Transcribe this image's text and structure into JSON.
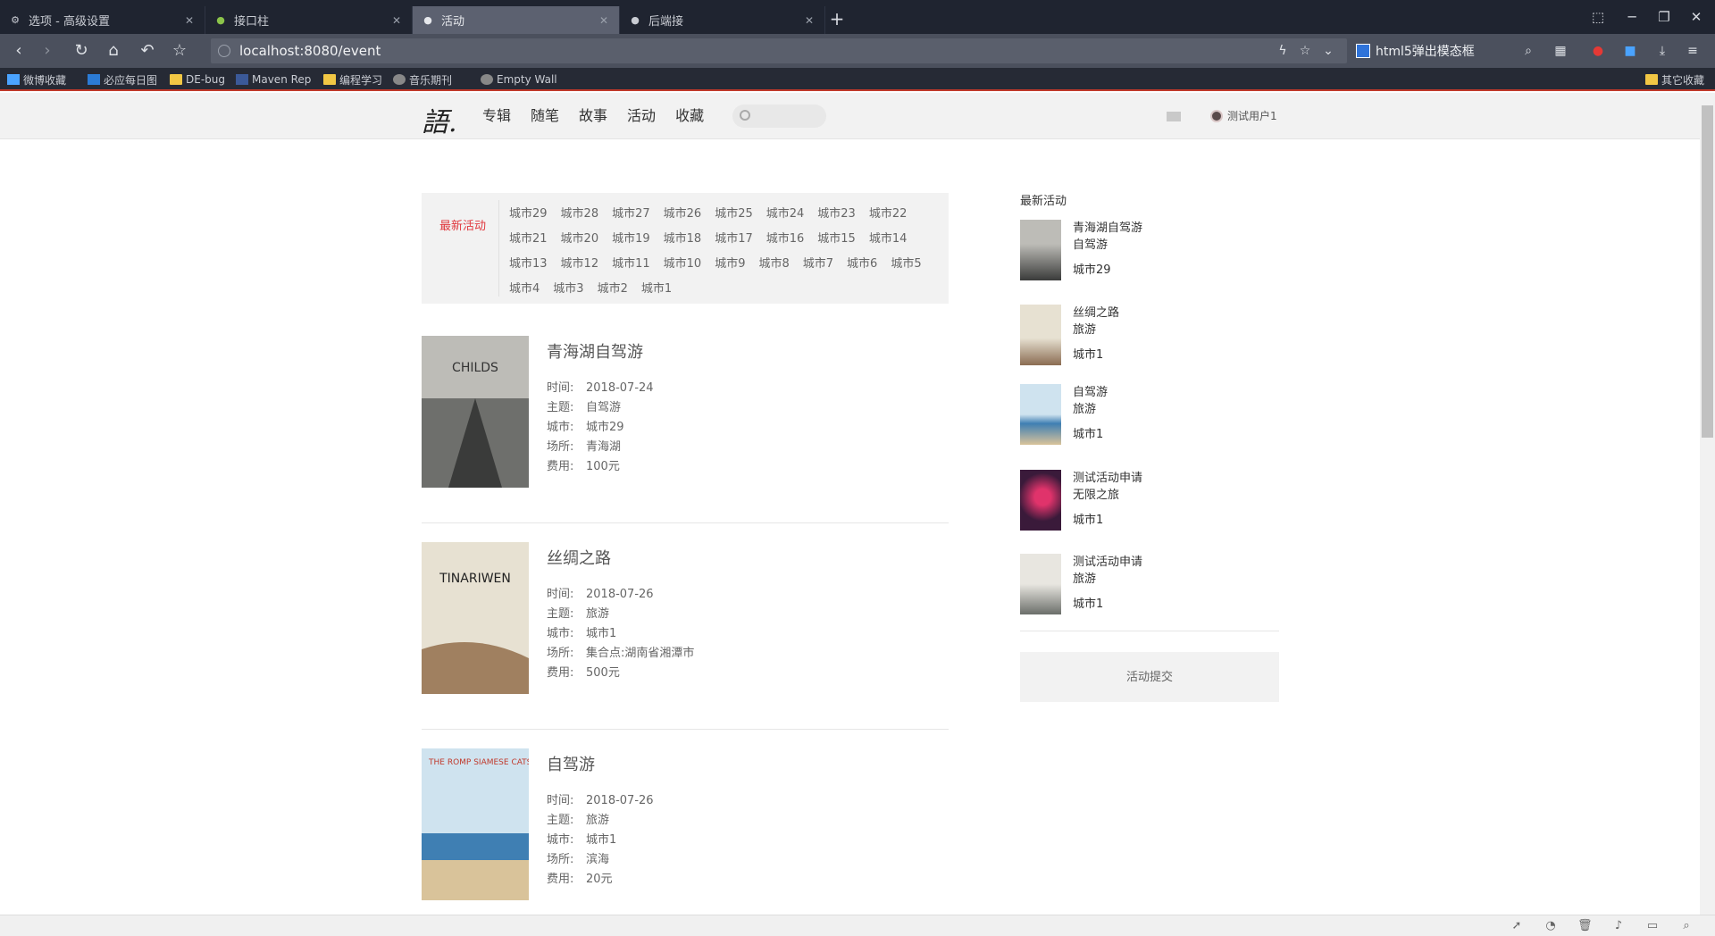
{
  "browser": {
    "tabs": [
      {
        "title": "选项 - 高级设置",
        "icon": "gear-icon"
      },
      {
        "title": "接口柱",
        "icon": "leaf-icon"
      },
      {
        "title": "活动",
        "icon": "site-icon",
        "active": true
      },
      {
        "title": "后端接",
        "icon": "site-icon"
      }
    ],
    "url": "localhost:8080/event",
    "search_engine": "html5弹出模态框",
    "bookmarks": [
      "微博收藏",
      "必应每日图",
      "DE-bug",
      "Maven Rep",
      "编程学习",
      "音乐期刊",
      "Empty Wall"
    ],
    "bookmark_right": "其它收藏"
  },
  "site": {
    "logo": "語.",
    "nav": [
      "专辑",
      "随笔",
      "故事",
      "活动",
      "收藏"
    ],
    "user": "测试用户1"
  },
  "filter": {
    "label": "最新活动",
    "cities": [
      "城市29",
      "城市28",
      "城市27",
      "城市26",
      "城市25",
      "城市24",
      "城市23",
      "城市22",
      "城市21",
      "城市20",
      "城市19",
      "城市18",
      "城市17",
      "城市16",
      "城市15",
      "城市14",
      "城市13",
      "城市12",
      "城市11",
      "城市10",
      "城市9",
      "城市8",
      "城市7",
      "城市6",
      "城市5",
      "城市4",
      "城市3",
      "城市2",
      "城市1"
    ]
  },
  "labels": {
    "time": "时间:",
    "theme": "主题:",
    "city": "城市:",
    "venue": "场所:",
    "fee": "费用:"
  },
  "events": [
    {
      "title": "青海湖自驾游",
      "time": "2018-07-24",
      "theme": "自驾游",
      "city": "城市29",
      "venue": "青海湖",
      "fee": "100元",
      "poster_text": "CHILDS"
    },
    {
      "title": "丝绸之路",
      "time": "2018-07-26",
      "theme": "旅游",
      "city": "城市1",
      "venue": "集合点:湖南省湘潭市",
      "fee": "500元",
      "poster_text": "TINARIWEN"
    },
    {
      "title": "自驾游",
      "time": "2018-07-26",
      "theme": "旅游",
      "city": "城市1",
      "venue": "滨海",
      "fee": "20元",
      "poster_text": "THE ROMP SIAMESE CATS"
    }
  ],
  "sidebar": {
    "title": "最新活动",
    "items": [
      {
        "name": "青海湖自驾游",
        "theme": "自驾游",
        "city": "城市29"
      },
      {
        "name": "丝绸之路",
        "theme": "旅游",
        "city": "城市1"
      },
      {
        "name": "自驾游",
        "theme": "旅游",
        "city": "城市1"
      },
      {
        "name": "测试活动申请",
        "theme": "无限之旅",
        "city": "城市1"
      },
      {
        "name": "测试活动申请",
        "theme": "旅游",
        "city": "城市1"
      }
    ],
    "submit": "活动提交"
  }
}
